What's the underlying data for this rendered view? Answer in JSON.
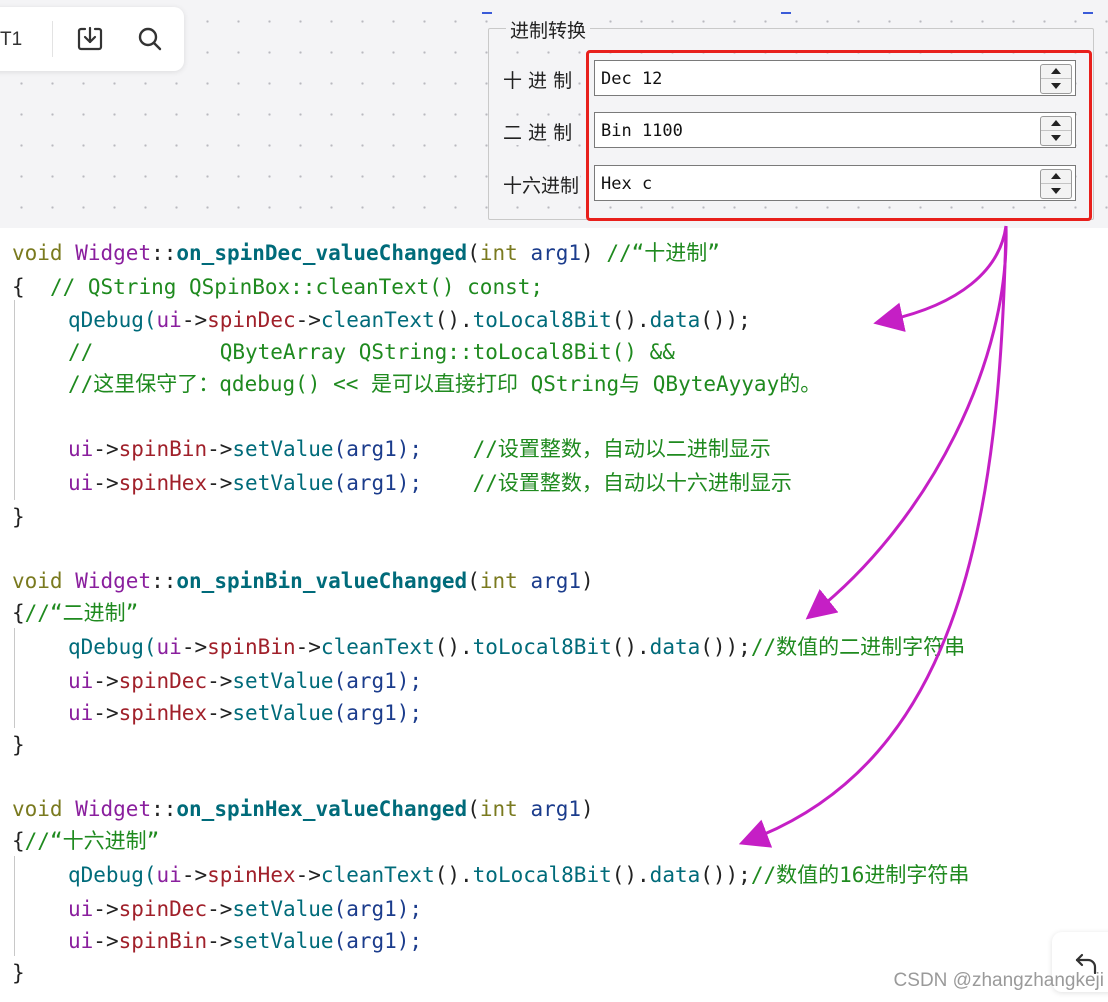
{
  "toolbar": {
    "tab_label": "T1",
    "icons": [
      "download-icon",
      "search-icon"
    ]
  },
  "group": {
    "title": "进制转换",
    "rows": [
      {
        "label": "十 进 制",
        "value": "Dec 12"
      },
      {
        "label": "二 进 制",
        "value": "Bin 1100"
      },
      {
        "label": "十六进制",
        "value": "Hex c"
      }
    ]
  },
  "code": {
    "f1": {
      "l1": [
        "void",
        "Widget",
        "::",
        "on_spinDec_valueChanged",
        "(",
        "int",
        "arg1",
        ") ",
        "//“十进制”"
      ],
      "l2": [
        "{",
        "  // QString QSpinBox::cleanText() const;"
      ],
      "l3": [
        "qDebug(",
        "ui",
        "->",
        "spinDec",
        "->",
        "cleanText",
        "().",
        "toLocal8Bit",
        "().",
        "data",
        "());"
      ],
      "l4": "//          QByteArray QString::toLocal8Bit() &&",
      "l5": "//这里保守了：qdebug() << 是可以直接打印 QString与 QByteAyyay的。",
      "l6": [
        "ui",
        "->",
        "spinBin",
        "->",
        "setValue",
        "(arg1);",
        "    //设置整数，自动以二进制显示"
      ],
      "l7": [
        "ui",
        "->",
        "spinHex",
        "->",
        "setValue",
        "(arg1);",
        "    //设置整数，自动以十六进制显示"
      ],
      "l8": "}"
    },
    "f2": {
      "l1": [
        "void",
        "Widget",
        "::",
        "on_spinBin_valueChanged",
        "(",
        "int",
        "arg1",
        ")"
      ],
      "l2": [
        "{",
        "//“二进制”"
      ],
      "l3": [
        "qDebug(",
        "ui",
        "->",
        "spinBin",
        "->",
        "cleanText",
        "().",
        "toLocal8Bit",
        "().",
        "data",
        "());",
        "//数值的二进制字符串"
      ],
      "l4": [
        "ui",
        "->",
        "spinDec",
        "->",
        "setValue",
        "(arg1);"
      ],
      "l5": [
        "ui",
        "->",
        "spinHex",
        "->",
        "setValue",
        "(arg1);"
      ],
      "l6": "}"
    },
    "f3": {
      "l1": [
        "void",
        "Widget",
        "::",
        "on_spinHex_valueChanged",
        "(",
        "int",
        "arg1",
        ")"
      ],
      "l2": [
        "{",
        "//“十六进制”"
      ],
      "l3": [
        "qDebug(",
        "ui",
        "->",
        "spinHex",
        "->",
        "cleanText",
        "().",
        "toLocal8Bit",
        "().",
        "data",
        "());",
        "//数值的16进制字符串"
      ],
      "l4": [
        "ui",
        "->",
        "spinDec",
        "->",
        "setValue",
        "(arg1);"
      ],
      "l5": [
        "ui",
        "->",
        "spinBin",
        "->",
        "setValue",
        "(arg1);"
      ],
      "l6": "}"
    }
  },
  "colors": {
    "highlight_border": "#e8201c",
    "annotation_arrow": "#c51fc5"
  },
  "undo_icon": "undo-icon",
  "watermark": "CSDN @zhangzhangkeji"
}
